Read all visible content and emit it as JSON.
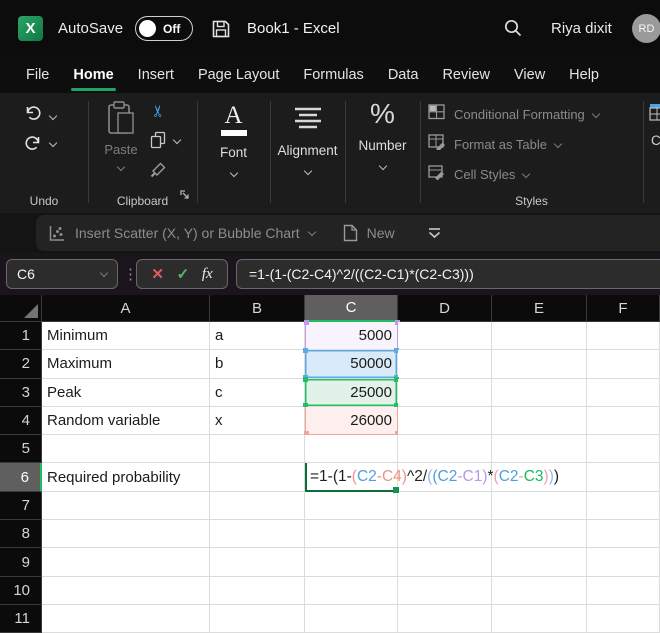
{
  "titlebar": {
    "autosave_label": "AutoSave",
    "autosave_state": "Off",
    "document_title": "Book1 - Excel",
    "user_name": "Riya dixit",
    "user_initials": "RD",
    "logo_letter": "X"
  },
  "menubar": {
    "items": [
      "File",
      "Home",
      "Insert",
      "Page Layout",
      "Formulas",
      "Data",
      "Review",
      "View",
      "Help"
    ],
    "active": "Home"
  },
  "ribbon": {
    "undo_group_label": "Undo",
    "clipboard_group_label": "Clipboard",
    "paste_label": "Paste",
    "font_group_label": "Font",
    "alignment_group_label": "Alignment",
    "number_group_label": "Number",
    "styles_group_label": "Styles",
    "styles_items": [
      "Conditional Formatting",
      "Format as Table",
      "Cell Styles"
    ],
    "cells_group_partial": "C"
  },
  "qat": {
    "scatter_label": "Insert Scatter (X, Y) or Bubble Chart",
    "new_label": "New"
  },
  "formula_bar": {
    "name_box": "C6",
    "separator_dots": "⋮",
    "cancel_glyph": "✕",
    "enter_glyph": "✓",
    "fx_glyph": "fx",
    "formula": "=1-(1-(C2-C4)^2/((C2-C1)*(C2-C3)))"
  },
  "grid": {
    "column_headers": [
      "A",
      "B",
      "C",
      "D",
      "E",
      "F"
    ],
    "row_headers": [
      "1",
      "2",
      "3",
      "4",
      "5",
      "6",
      "7",
      "8",
      "9",
      "10",
      "11"
    ],
    "selected_column": "C",
    "selected_row": "6",
    "cells": {
      "A1": "Minimum",
      "B1": "a",
      "C1": "5000",
      "A2": "Maximum",
      "B2": "b",
      "C2": "50000",
      "A3": "Peak",
      "B3": "c",
      "C3": "25000",
      "A4": "Random variable",
      "B4": "x",
      "C4": "26000",
      "A6": "Required probability"
    },
    "reference_highlights": {
      "C1": "purple",
      "C2": "blue",
      "C3": "green",
      "C4": "red"
    },
    "editing_cell": "C6",
    "c6_segments": [
      {
        "text": "=1-(1-",
        "color": "#1f1f1f"
      },
      {
        "text": "(",
        "color": "#f0908a"
      },
      {
        "text": "C2",
        "color": "#4d9fe0"
      },
      {
        "text": "-",
        "color": "#f0908a"
      },
      {
        "text": "C4",
        "color": "#f0908a"
      },
      {
        "text": ")",
        "color": "#f0908a"
      },
      {
        "text": "^2/",
        "color": "#1f1f1f"
      },
      {
        "text": "(",
        "color": "#93b8ef"
      },
      {
        "text": "(",
        "color": "#4d9fe0"
      },
      {
        "text": "C2",
        "color": "#4d9fe0"
      },
      {
        "text": "-",
        "color": "#b897e6"
      },
      {
        "text": "C1",
        "color": "#b897e6"
      },
      {
        "text": ")",
        "color": "#b897e6"
      },
      {
        "text": "*",
        "color": "#1f1f1f"
      },
      {
        "text": "(",
        "color": "#ef9eb4"
      },
      {
        "text": "C2",
        "color": "#4d9fe0"
      },
      {
        "text": "-",
        "color": "#ef9eb4"
      },
      {
        "text": "C3",
        "color": "#14bd5f"
      },
      {
        "text": ")",
        "color": "#ef9eb4"
      },
      {
        "text": ")",
        "color": "#93b8ef"
      },
      {
        "text": ")",
        "color": "#1f1f1f"
      }
    ]
  },
  "colors": {
    "accent_green": "#1dbe62",
    "menu_underline": "#21a366",
    "ref_blue": "#5ea9e6",
    "ref_blue_fill": "#d9eaf8",
    "ref_purple": "#c09ae4",
    "ref_purple_fill": "#f8f3fc",
    "ref_green": "#1ec05f",
    "ref_green_fill": "#e2f2e8",
    "ref_red": "#f2a49c",
    "ref_red_fill": "#fdefed",
    "editing_border": "#0e6b3a"
  }
}
